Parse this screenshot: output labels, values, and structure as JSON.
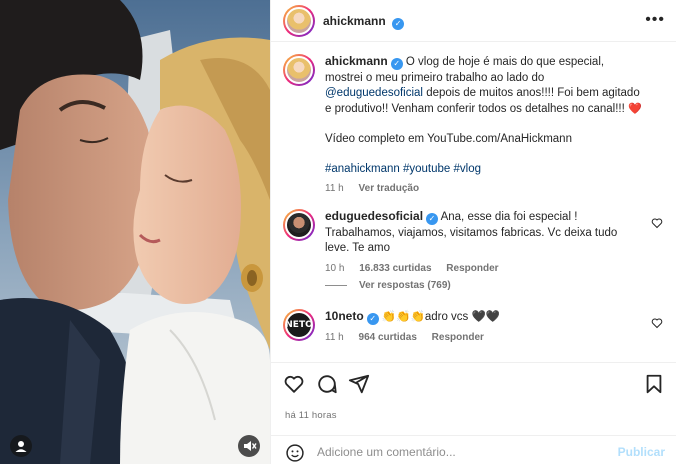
{
  "post": {
    "author": "ahickmann",
    "more_icon": "more-horizontal-icon"
  },
  "caption": {
    "username": "ahickmann",
    "text_part1": " O vlog de hoje é mais do que especial, mostrei o meu primeiro trabalho ao lado do ",
    "mention": "@eduguedesoficial",
    "text_part2": " depois de muitos anos!!!! Foi bem agitado e produtivo!! Venham conferir todos os detalhes no canal!!! ",
    "heart": "❤️",
    "video_line": "Vídeo completo em YouTube.com/AnaHickmann",
    "hashtags": "#anahickmann #youtube #vlog",
    "time": "11 h",
    "translate": "Ver tradução"
  },
  "comments": [
    {
      "username": "eduguedesoficial",
      "text": " Ana, esse dia foi especial ! Trabalhamos, viajamos, visitamos fabricas. Vc deixa tudo leve. Te amo",
      "time": "10 h",
      "likes": "16.833 curtidas",
      "reply": "Responder",
      "view_replies": "Ver respostas (769)"
    },
    {
      "username": "10neto",
      "text": " 👏👏👏adro vcs 🖤🖤",
      "time": "11 h",
      "likes": "964 curtidas",
      "reply": "Responder",
      "avatar_text": "NETO"
    }
  ],
  "actions": {
    "icons": [
      "heart-icon",
      "comment-icon",
      "share-icon",
      "bookmark-icon"
    ],
    "time_ago": "há 11 horas"
  },
  "add_comment": {
    "placeholder": "Adicione um comentário...",
    "publish_label": "Publicar"
  },
  "colors": {
    "verified": "#3897f0",
    "link": "#00376b",
    "muted": "#737373",
    "publish_disabled": "#b2dffc"
  }
}
